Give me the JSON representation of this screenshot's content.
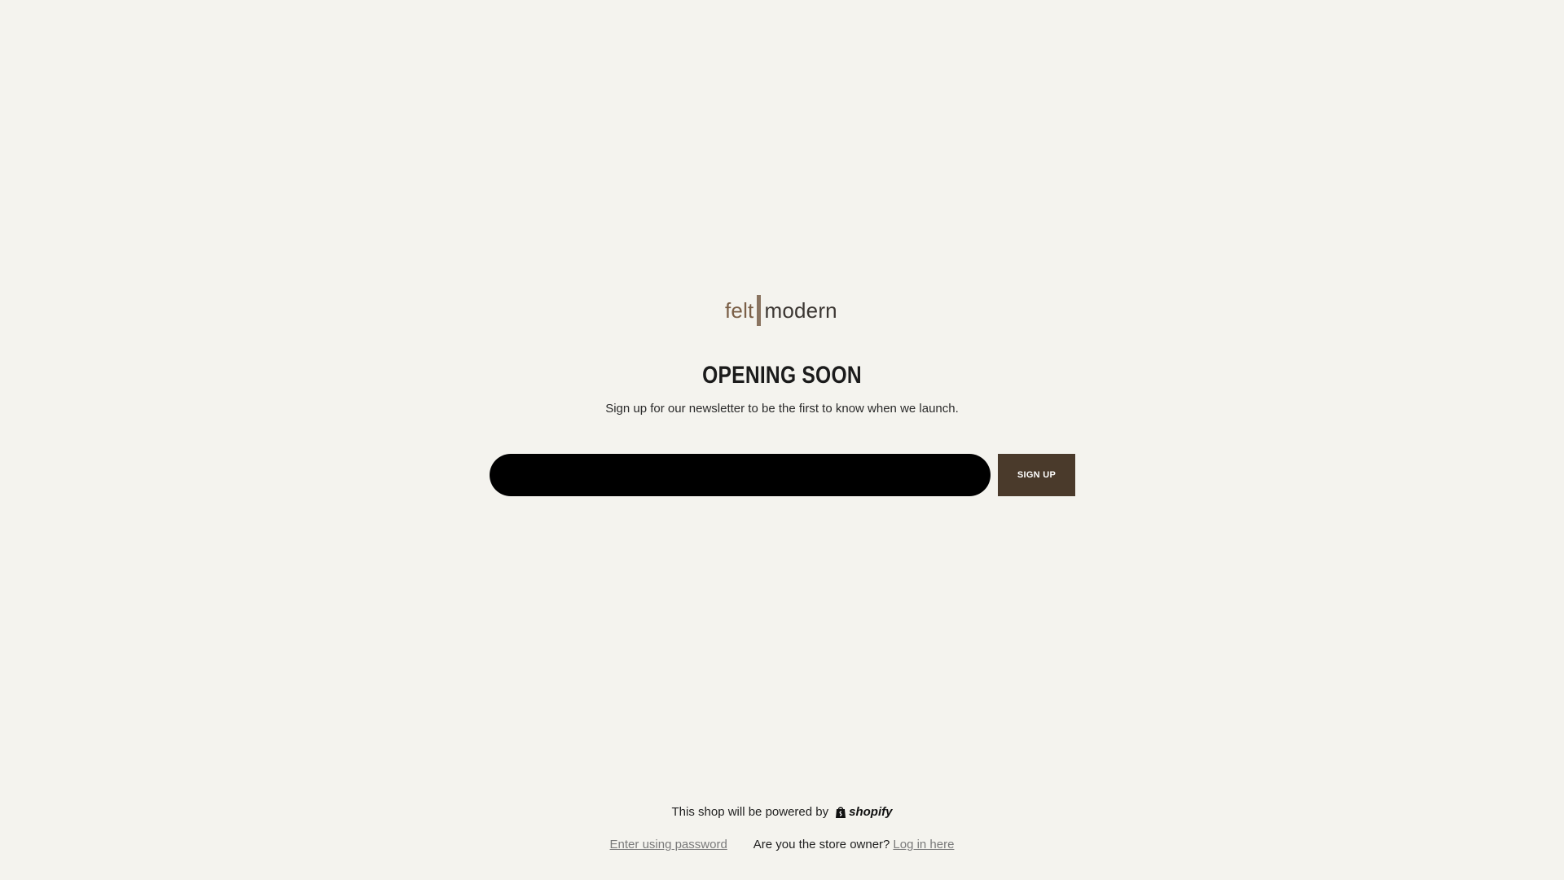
{
  "brand": {
    "logo_part1": "felt",
    "logo_part2": "modern"
  },
  "hero": {
    "title": "OPENING SOON",
    "subtitle": "Sign up for our newsletter to be the first to know when we launch."
  },
  "newsletter": {
    "email_value": "",
    "email_placeholder": "",
    "button_label": "SIGN UP"
  },
  "footer": {
    "powered_by": "This shop will be powered by",
    "shopify_wordmark": "shopify",
    "password_link": "Enter using password",
    "owner_question": "Are you the store owner?",
    "login_link": "Log in here"
  },
  "colors": {
    "background": "#f4f3ee",
    "button": "#4a3a2b",
    "input": "#000000",
    "logo_felt": "#7a5f47",
    "logo_bar": "#8a7460"
  },
  "icons": {
    "shopify_bag": "shopping-bag-icon"
  }
}
